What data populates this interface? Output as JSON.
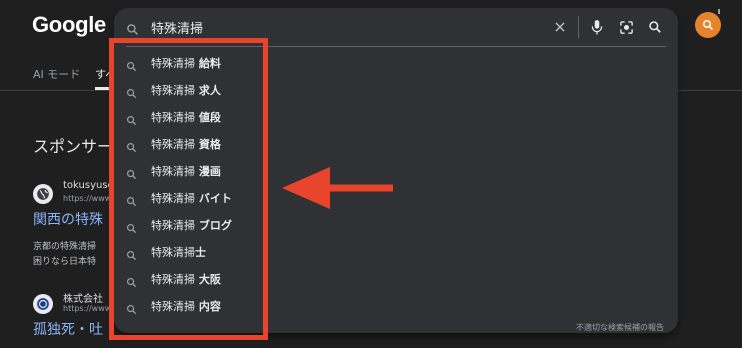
{
  "header": {
    "logo": "Google"
  },
  "search": {
    "query": "特殊清掃",
    "clear_icon": "close-icon",
    "voice_icon": "mic-icon",
    "lens_icon": "lens-icon",
    "search_icon": "search-icon"
  },
  "suggestions": [
    {
      "prefix": "特殊清掃",
      "suffix": " 給料"
    },
    {
      "prefix": "特殊清掃",
      "suffix": " 求人"
    },
    {
      "prefix": "特殊清掃",
      "suffix": " 値段"
    },
    {
      "prefix": "特殊清掃",
      "suffix": " 資格"
    },
    {
      "prefix": "特殊清掃",
      "suffix": " 漫画"
    },
    {
      "prefix": "特殊清掃",
      "suffix": " バイト"
    },
    {
      "prefix": "特殊清掃",
      "suffix": " ブログ"
    },
    {
      "prefix": "特殊清掃",
      "suffix": "士"
    },
    {
      "prefix": "特殊清掃",
      "suffix": " 大阪"
    },
    {
      "prefix": "特殊清掃",
      "suffix": " 内容"
    }
  ],
  "report_link": "不適切な検索候補の報告",
  "tabs": [
    {
      "label": "AI モード"
    },
    {
      "label": "すべ"
    }
  ],
  "results": {
    "sponsor_heading": "スポンサー",
    "ads": [
      {
        "site": "tokusyuse",
        "url": "https://www",
        "title": "関西の特殊",
        "desc": [
          "京都の特殊清掃",
          "困りなら日本特"
        ]
      },
      {
        "site": "株式会社",
        "url": "https://www",
        "title": "孤独死・吐"
      }
    ]
  },
  "annotation": {
    "color": "#e8432b"
  },
  "colors": {
    "background": "#1f1f1f",
    "panel": "#303134",
    "link": "#8ab4f8",
    "avatar": "#e8832d"
  }
}
